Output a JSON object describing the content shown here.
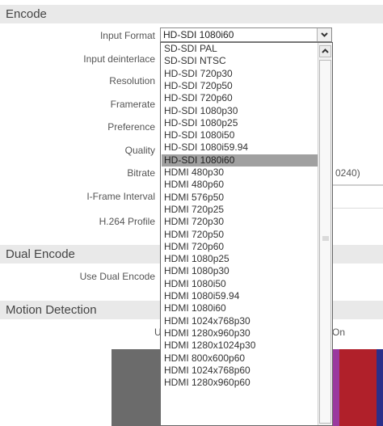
{
  "sections": {
    "encode": "Encode",
    "dual_encode": "Dual Encode",
    "motion_detection": "Motion Detection"
  },
  "labels": {
    "input_format": "Input Format",
    "input_deinterlace": "Input deinterlace",
    "resolution": "Resolution",
    "framerate": "Framerate",
    "preference": "Preference",
    "quality": "Quality",
    "bitrate": "Bitrate",
    "iframe_interval": "I-Frame Interval",
    "h264_profile": "H.264 Profile",
    "use_dual_encode": "Use Dual Encode",
    "motion_use_fragment": "U",
    "bitrate_range_fragment": "0240)",
    "motion_on_fragment": "On"
  },
  "input_format_select": {
    "value": "HD-SDI 1080i60",
    "options": [
      "SD-SDI PAL",
      "SD-SDI NTSC",
      "HD-SDI 720p30",
      "HD-SDI 720p50",
      "HD-SDI 720p60",
      "HD-SDI 1080p30",
      "HD-SDI 1080p25",
      "HD-SDI 1080i50",
      "HD-SDI 1080i59.94",
      "HD-SDI 1080i60",
      "HDMI 480p30",
      "HDMI 480p60",
      "HDMI 576p50",
      "HDMI 720p25",
      "HDMI 720p30",
      "HDMI 720p50",
      "HDMI 720p60",
      "HDMI 1080p25",
      "HDMI 1080p30",
      "HDMI 1080i50",
      "HDMI 1080i59.94",
      "HDMI 1080i60",
      "HDMI 1024x768p30",
      "HDMI 1280x960p30",
      "HDMI 1280x1024p30",
      "HDMI 800x600p60",
      "HDMI 1024x768p60",
      "HDMI 1280x960p60"
    ],
    "selected_index": 9
  },
  "colors": {
    "section_bg": "#e9e9e9",
    "selected_bg": "#a0a0a0",
    "preview_gray": "#6b6b6b",
    "preview_purple": "#9a3a9e",
    "preview_red": "#b0202a",
    "preview_blue": "#2a2f8a"
  }
}
